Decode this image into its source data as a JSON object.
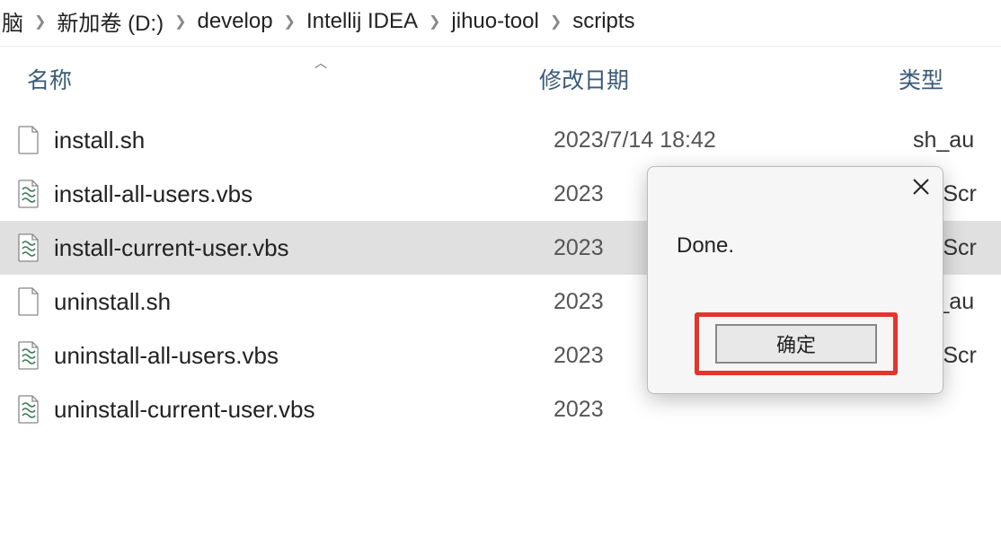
{
  "breadcrumb": [
    "脑",
    "新加卷 (D:)",
    "develop",
    "Intellij IDEA",
    "jihuo-tool",
    "scripts"
  ],
  "columns": {
    "name": "名称",
    "date": "修改日期",
    "type": "类型"
  },
  "files": [
    {
      "icon": "file",
      "name": "install.sh",
      "date": "2023/7/14 18:42",
      "type": "sh_au",
      "selected": false
    },
    {
      "icon": "vbs",
      "name": "install-all-users.vbs",
      "date": "2023",
      "type": "VBScr",
      "selected": false
    },
    {
      "icon": "vbs",
      "name": "install-current-user.vbs",
      "date": "2023",
      "type": "VBScr",
      "selected": true
    },
    {
      "icon": "file",
      "name": "uninstall.sh",
      "date": "2023",
      "type": "sh_au",
      "selected": false
    },
    {
      "icon": "vbs",
      "name": "uninstall-all-users.vbs",
      "date": "2023",
      "type": "VBScr",
      "selected": false
    },
    {
      "icon": "vbs",
      "name": "uninstall-current-user.vbs",
      "date": "2023",
      "type": "",
      "selected": false
    }
  ],
  "dialog": {
    "message": "Done.",
    "ok": "确定"
  }
}
